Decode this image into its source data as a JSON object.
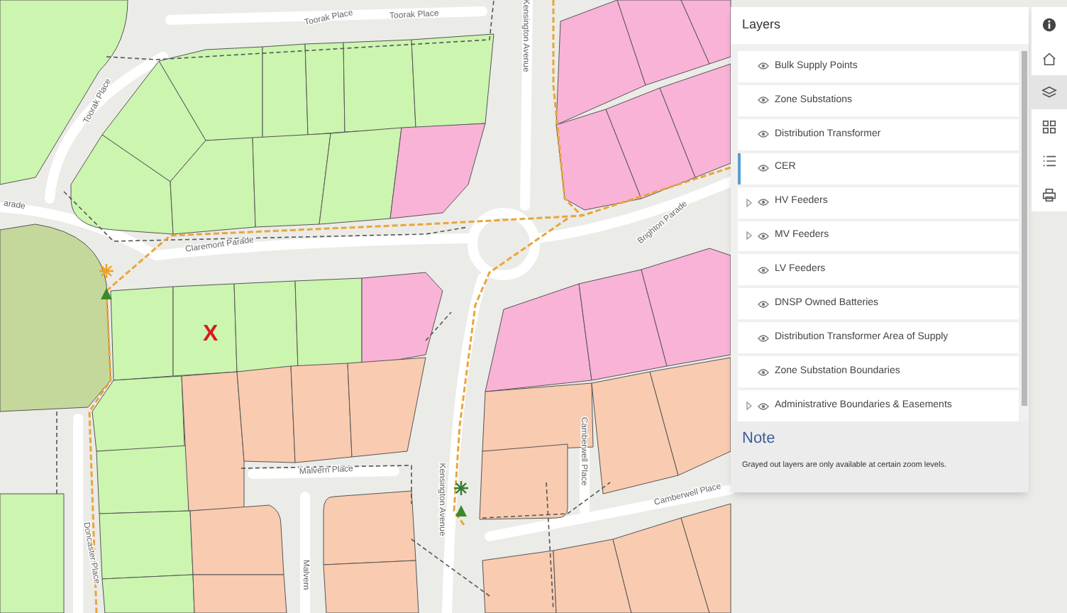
{
  "map": {
    "street_labels": [
      "Toorak Place",
      "Toorak Place",
      "Toorak Place",
      "Kensington Avenue",
      "arade",
      "Claremont Parade",
      "Brighton Parade",
      "Malvern Place",
      "Kensington Avenue",
      "Camberwell Place",
      "Camberwell Place",
      "Doncaster Place",
      "Malvern"
    ],
    "marker": "X"
  },
  "layers_panel": {
    "title": "Layers",
    "layers": [
      {
        "label": "Bulk Supply Points",
        "expandable": false,
        "selected": false
      },
      {
        "label": "Zone Substations",
        "expandable": false,
        "selected": false
      },
      {
        "label": "Distribution Transformer",
        "expandable": false,
        "selected": false
      },
      {
        "label": "CER",
        "expandable": false,
        "selected": true
      },
      {
        "label": "HV Feeders",
        "expandable": true,
        "selected": false
      },
      {
        "label": "MV Feeders",
        "expandable": true,
        "selected": false
      },
      {
        "label": "LV Feeders",
        "expandable": false,
        "selected": false
      },
      {
        "label": "DNSP Owned Batteries",
        "expandable": false,
        "selected": false
      },
      {
        "label": "Distribution Transformer Area of Supply",
        "expandable": false,
        "selected": false
      },
      {
        "label": "Zone Substation Boundaries",
        "expandable": false,
        "selected": false
      },
      {
        "label": "Administrative Boundaries & Easements",
        "expandable": true,
        "selected": false
      }
    ],
    "note": {
      "heading": "Note",
      "text": "Grayed out layers are only available at certain zoom levels."
    }
  },
  "toolbar": [
    {
      "kind": "info",
      "selected": false
    },
    {
      "kind": "home",
      "selected": false
    },
    {
      "kind": "layers",
      "selected": true
    },
    {
      "kind": "grid",
      "selected": false
    },
    {
      "kind": "list",
      "selected": false
    },
    {
      "kind": "print",
      "selected": false
    }
  ]
}
